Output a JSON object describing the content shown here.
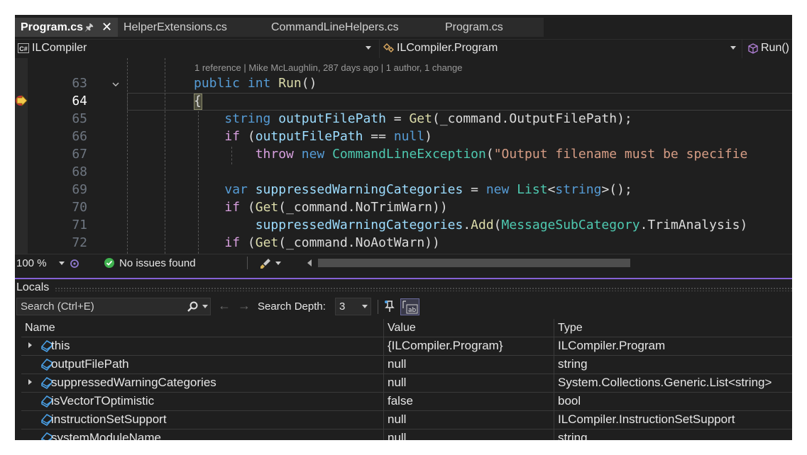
{
  "tabs": [
    {
      "label": "Program.cs",
      "active": true
    },
    {
      "label": "HelperExtensions.cs",
      "active": false
    },
    {
      "label": "CommandLineHelpers.cs",
      "active": false
    },
    {
      "label": "Program.cs",
      "active": false
    }
  ],
  "tab_icons": {
    "pin": "pin-icon",
    "close": "close-icon"
  },
  "navbar": {
    "project": "ILCompiler",
    "project_badge": "C#",
    "type": "ILCompiler.Program",
    "member": "Run()"
  },
  "editor": {
    "codelens": "1 reference | Mike McLaughlin, 287 days ago | 1 author, 1 change",
    "current_line": 64,
    "lines": [
      {
        "num": "63",
        "tokens": [
          {
            "t": "public",
            "c": "kw"
          },
          {
            "t": " ",
            "c": ""
          },
          {
            "t": "int",
            "c": "kw"
          },
          {
            "t": " ",
            "c": ""
          },
          {
            "t": "Run",
            "c": "fn"
          },
          {
            "t": "()",
            "c": ""
          }
        ]
      },
      {
        "num": "64",
        "tokens": [
          {
            "t": "{",
            "c": ""
          }
        ]
      },
      {
        "num": "65",
        "tokens": [
          {
            "t": "    ",
            "c": ""
          },
          {
            "t": "string",
            "c": "kw"
          },
          {
            "t": " ",
            "c": ""
          },
          {
            "t": "outputFilePath",
            "c": "vr"
          },
          {
            "t": " = ",
            "c": ""
          },
          {
            "t": "Get",
            "c": "fn"
          },
          {
            "t": "(_command.",
            "c": ""
          },
          {
            "t": "OutputFilePath",
            "c": ""
          },
          {
            "t": ");",
            "c": ""
          }
        ]
      },
      {
        "num": "66",
        "tokens": [
          {
            "t": "    ",
            "c": ""
          },
          {
            "t": "if",
            "c": "ck"
          },
          {
            "t": " (",
            "c": ""
          },
          {
            "t": "outputFilePath",
            "c": "vr"
          },
          {
            "t": " == ",
            "c": ""
          },
          {
            "t": "null",
            "c": "kw"
          },
          {
            "t": ")",
            "c": ""
          }
        ]
      },
      {
        "num": "67",
        "tokens": [
          {
            "t": "        ",
            "c": ""
          },
          {
            "t": "throw",
            "c": "ck"
          },
          {
            "t": " ",
            "c": ""
          },
          {
            "t": "new",
            "c": "kw"
          },
          {
            "t": " ",
            "c": ""
          },
          {
            "t": "CommandLineException",
            "c": "ty"
          },
          {
            "t": "(",
            "c": ""
          },
          {
            "t": "\"Output filename must be specifie",
            "c": "st"
          }
        ]
      },
      {
        "num": "68",
        "tokens": []
      },
      {
        "num": "69",
        "tokens": [
          {
            "t": "    ",
            "c": ""
          },
          {
            "t": "var",
            "c": "kw"
          },
          {
            "t": " ",
            "c": ""
          },
          {
            "t": "suppressedWarningCategories",
            "c": "vr"
          },
          {
            "t": " = ",
            "c": ""
          },
          {
            "t": "new",
            "c": "kw"
          },
          {
            "t": " ",
            "c": ""
          },
          {
            "t": "List",
            "c": "ty"
          },
          {
            "t": "<",
            "c": ""
          },
          {
            "t": "string",
            "c": "kw"
          },
          {
            "t": ">();",
            "c": ""
          }
        ]
      },
      {
        "num": "70",
        "tokens": [
          {
            "t": "    ",
            "c": ""
          },
          {
            "t": "if",
            "c": "ck"
          },
          {
            "t": " (",
            "c": ""
          },
          {
            "t": "Get",
            "c": "fn"
          },
          {
            "t": "(_command.NoTrimWarn))",
            "c": ""
          }
        ]
      },
      {
        "num": "71",
        "tokens": [
          {
            "t": "        ",
            "c": ""
          },
          {
            "t": "suppressedWarningCategories",
            "c": "vr"
          },
          {
            "t": ".",
            "c": ""
          },
          {
            "t": "Add",
            "c": "fn"
          },
          {
            "t": "(",
            "c": ""
          },
          {
            "t": "MessageSubCategory",
            "c": "ty"
          },
          {
            "t": ".TrimAnalysis)",
            "c": ""
          }
        ]
      },
      {
        "num": "72",
        "tokens": [
          {
            "t": "    ",
            "c": ""
          },
          {
            "t": "if",
            "c": "ck"
          },
          {
            "t": " (",
            "c": ""
          },
          {
            "t": "Get",
            "c": "fn"
          },
          {
            "t": "(_command.NoAotWarn))",
            "c": ""
          }
        ]
      }
    ]
  },
  "status": {
    "zoom": "100 %",
    "issues": "No issues found"
  },
  "locals": {
    "title": "Locals",
    "search_placeholder": "Search (Ctrl+E)",
    "depth_label": "Search Depth:",
    "depth_value": "3",
    "columns": [
      "Name",
      "Value",
      "Type"
    ],
    "rows": [
      {
        "name": "this",
        "value": "{ILCompiler.Program}",
        "type": "ILCompiler.Program",
        "expandable": true
      },
      {
        "name": "outputFilePath",
        "value": "null",
        "type": "string",
        "expandable": false
      },
      {
        "name": "suppressedWarningCategories",
        "value": "null",
        "type": "System.Collections.Generic.List<string>",
        "expandable": true
      },
      {
        "name": "isVectorTOptimistic",
        "value": "false",
        "type": "bool",
        "expandable": false
      },
      {
        "name": "instructionSetSupport",
        "value": "null",
        "type": "ILCompiler.InstructionSetSupport",
        "expandable": false
      },
      {
        "name": "systemModuleName",
        "value": "null",
        "type": "string",
        "expandable": false
      }
    ]
  },
  "colors": {
    "editor_bg": "#1f1f1f",
    "accent": "#8562d6",
    "keyword": "#569cd6",
    "type": "#4ec9b0",
    "string": "#d69d85"
  }
}
